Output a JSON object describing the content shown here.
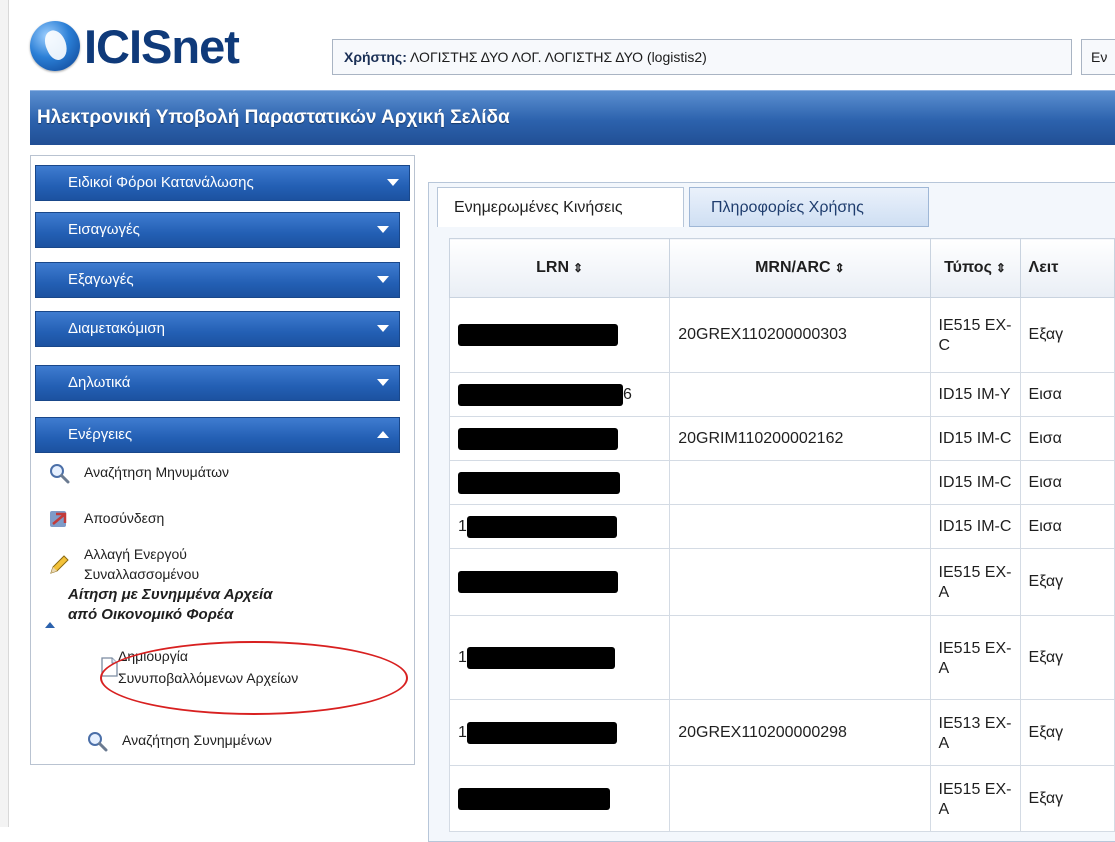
{
  "app": {
    "logo": "ICISnet"
  },
  "header": {
    "user_label": "Χρήστης:",
    "user_value": "ΛΟΓΙΣΤΗΣ ΔΥΟ ΛΟΓ. ΛΟΓΙΣΤΗΣ ΔΥΟ (logistis2)",
    "side_box": "Εν"
  },
  "title": "Ηλεκτρονική Υποβολή Παραστατικών Αρχική Σελίδα",
  "sidebar": {
    "menus": [
      {
        "label": "Ειδικοί Φόροι Κατανάλωσης",
        "expanded": false
      },
      {
        "label": "Εισαγωγές",
        "expanded": false
      },
      {
        "label": "Εξαγωγές",
        "expanded": false
      },
      {
        "label": "Διαμετακόμιση",
        "expanded": false
      },
      {
        "label": "Δηλωτικά",
        "expanded": false
      },
      {
        "label": "Ενέργειες",
        "expanded": true
      }
    ],
    "items": [
      {
        "label": "Αναζήτηση Μηνυμάτων",
        "icon": "magnifier-icon"
      },
      {
        "label": "Αποσύνδεση",
        "icon": "logout-icon"
      },
      {
        "label_line1": "Αλλαγή Ενεργού",
        "label_line2": "Συναλλασσομένου",
        "icon": "pencil-icon"
      }
    ],
    "subsection": {
      "line1": "Αίτηση με Συνημμένα Αρχεία",
      "line2": "από Οικονομικό Φορέα"
    },
    "subitems": [
      {
        "label_line1": "Δημιουργία",
        "label_line2": "Συνυποβαλλόμενων Αρχείων",
        "icon": "document-icon"
      },
      {
        "label": "Αναζήτηση Συνημμένων",
        "icon": "magnifier-icon"
      }
    ],
    "highlight_color": "#d82020"
  },
  "tabs": [
    {
      "label": "Ενημερωμένες Κινήσεις",
      "active": true
    },
    {
      "label": "Πληροφορίες Χρήσης",
      "active": false
    }
  ],
  "table": {
    "headers": [
      "LRN",
      "MRN/ARC",
      "Τύπος",
      "Λειτ"
    ],
    "sort_glyph": "⇕",
    "rows": [
      {
        "lrn_visible": "",
        "mrn": "20GREX110200000303",
        "type_line1": "IE515 EX-",
        "type_line2": "C",
        "dir": "Εξαγ"
      },
      {
        "lrn_visible": "6",
        "mrn": "",
        "type_line1": "ID15 IM-Y",
        "type_line2": "",
        "dir": "Εισα"
      },
      {
        "lrn_visible": "",
        "mrn": "20GRIM110200002162",
        "type_line1": "ID15 IM-C",
        "type_line2": "",
        "dir": "Εισα"
      },
      {
        "lrn_visible": "",
        "mrn": "",
        "type_line1": "ID15 IM-C",
        "type_line2": "",
        "dir": "Εισα"
      },
      {
        "lrn_visible": "1",
        "mrn": "",
        "type_line1": "ID15 IM-C",
        "type_line2": "",
        "dir": "Εισα"
      },
      {
        "lrn_visible": "",
        "mrn": "",
        "type_line1": "IE515 EX-",
        "type_line2": "A",
        "dir": "Εξαγ"
      },
      {
        "lrn_visible": "1",
        "mrn": "",
        "type_line1": "IE515 EX-",
        "type_line2": "A",
        "dir": "Εξαγ"
      },
      {
        "lrn_visible": "1",
        "mrn": "20GREX110200000298",
        "type_line1": "IE513 EX-",
        "type_line2": "A",
        "dir": "Εξαγ"
      },
      {
        "lrn_visible": "",
        "mrn": "",
        "type_line1": "IE515 EX-",
        "type_line2": "A",
        "dir": "Εξαγ"
      }
    ]
  }
}
